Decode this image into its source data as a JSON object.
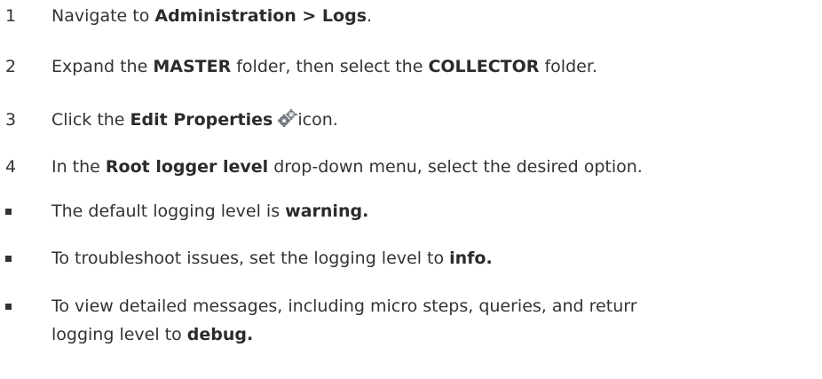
{
  "steps": [
    {
      "number": "1",
      "text_before": "Navigate to ",
      "bold_1": "Administration > Logs",
      "text_after": "."
    },
    {
      "number": "2",
      "text_before": "Expand the ",
      "bold_1": "MASTER",
      "text_middle": " folder, then select the ",
      "bold_2": "COLLECTOR",
      "text_after": " folder."
    },
    {
      "number": "3",
      "text_before": "Click the ",
      "bold_1": "Edit Properties",
      "icon": "edit-properties-gear-icon",
      "text_after": "icon."
    },
    {
      "number": "4",
      "text_before": "In the ",
      "bold_1": "Root logger level",
      "text_after": " drop-down menu, select the desired option."
    }
  ],
  "bullets": [
    {
      "text_before": "The default logging level is ",
      "bold": "warning."
    },
    {
      "text_before": "To troubleshoot issues, set the logging level to ",
      "bold": "info."
    },
    {
      "text_line1": "To view detailed messages, including micro steps, queries, and returr",
      "text_line2_before": "logging level to ",
      "bold": "debug."
    }
  ]
}
